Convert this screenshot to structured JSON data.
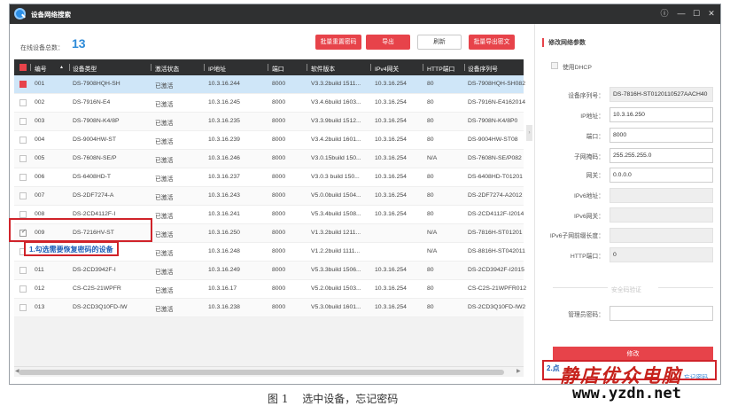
{
  "window": {
    "title": "设备网络搜索",
    "info_icon": "ⓘ",
    "min_icon": "—",
    "max_icon": "☐",
    "close_icon": "✕"
  },
  "toolbar": {
    "online_label": "在线设备总数：",
    "online_count": "13",
    "batch_reset_label": "批量重置密码",
    "export_label": "导出",
    "refresh_label": "刷新",
    "batch_export_label": "批量导出密文"
  },
  "table": {
    "columns": [
      "编号",
      "设备类型",
      "激活状态",
      "IP地址",
      "端口",
      "软件版本",
      "IPv4网关",
      "HTTP端口",
      "设备序列号"
    ],
    "rows": [
      {
        "id": "001",
        "type": "DS-7908HQH-SH",
        "status": "已激活",
        "ip": "10.3.16.244",
        "port": "8000",
        "version": "V3.3.2build 1511...",
        "gateway": "10.3.16.254",
        "http": "80",
        "serial": "DS-7908HQH-SH082"
      },
      {
        "id": "002",
        "type": "DS-7916N-E4",
        "status": "已激活",
        "ip": "10.3.16.245",
        "port": "8000",
        "version": "V3.4.6build 1603...",
        "gateway": "10.3.16.254",
        "http": "80",
        "serial": "DS-7916N-E4162014"
      },
      {
        "id": "003",
        "type": "DS-7908N-K4/8P",
        "status": "已激活",
        "ip": "10.3.16.235",
        "port": "8000",
        "version": "V3.3.9build 1512...",
        "gateway": "10.3.16.254",
        "http": "80",
        "serial": "DS-7908N-K4/8P0"
      },
      {
        "id": "004",
        "type": "DS-9004HW-ST",
        "status": "已激活",
        "ip": "10.3.16.239",
        "port": "8000",
        "version": "V3.4.2build 1601...",
        "gateway": "10.3.16.254",
        "http": "80",
        "serial": "DS-9004HW-ST08"
      },
      {
        "id": "005",
        "type": "DS-7608N-SE/P",
        "status": "已激活",
        "ip": "10.3.16.246",
        "port": "8000",
        "version": "V3.0.15build 150...",
        "gateway": "10.3.16.254",
        "http": "N/A",
        "serial": "DS-7608N-SE/P082"
      },
      {
        "id": "006",
        "type": "DS-6408HD-T",
        "status": "已激活",
        "ip": "10.3.16.237",
        "port": "8000",
        "version": "V3.0.3 build 150...",
        "gateway": "10.3.16.254",
        "http": "80",
        "serial": "DS-6408HD-T01201"
      },
      {
        "id": "007",
        "type": "DS-2DF7274-A",
        "status": "已激活",
        "ip": "10.3.16.243",
        "port": "8000",
        "version": "V5.0.0build 1504...",
        "gateway": "10.3.16.254",
        "http": "80",
        "serial": "DS-2DF7274-A2012"
      },
      {
        "id": "008",
        "type": "DS-2CD4112F-I",
        "status": "已激活",
        "ip": "10.3.16.241",
        "port": "8000",
        "version": "V5.3.4build 1508...",
        "gateway": "10.3.16.254",
        "http": "80",
        "serial": "DS-2CD4112F-I2014"
      },
      {
        "id": "009",
        "type": "DS-7216HV-ST",
        "status": "已激活",
        "ip": "10.3.16.250",
        "port": "8000",
        "version": "V1.3.2build 1211...",
        "gateway": "",
        "http": "N/A",
        "serial": "DS-7816H-ST01201"
      },
      {
        "id": "010",
        "type": "",
        "status": "已激活",
        "ip": "10.3.16.248",
        "port": "8000",
        "version": "V1.2.2build 1111...",
        "gateway": "",
        "http": "N/A",
        "serial": "DS-8816H-ST042011"
      },
      {
        "id": "011",
        "type": "DS-2CD3942F-I",
        "status": "已激活",
        "ip": "10.3.16.249",
        "port": "8000",
        "version": "V5.3.3build 1506...",
        "gateway": "10.3.16.254",
        "http": "80",
        "serial": "DS-2CD3942F-I2015"
      },
      {
        "id": "012",
        "type": "CS-C2S-21WPFR",
        "status": "已激活",
        "ip": "10.3.16.17",
        "port": "8000",
        "version": "V5.2.0build 1503...",
        "gateway": "10.3.16.254",
        "http": "80",
        "serial": "CS-C2S-21WPFR012"
      },
      {
        "id": "013",
        "type": "DS-2CD3Q10FD-IW",
        "status": "已激活",
        "ip": "10.3.16.238",
        "port": "8000",
        "version": "V5.3.0build 1601...",
        "gateway": "10.3.16.254",
        "http": "80",
        "serial": "DS-2CD3Q10FD-IW2"
      }
    ]
  },
  "panel": {
    "title": "修改网络参数",
    "dhcp_label": "使用DHCP",
    "serial_label": "设备序列号：",
    "serial_value": "DS-7816H-ST0120110527AACH40",
    "ip_label": "IP地址：",
    "ip_value": "10.3.16.250",
    "port_label": "端口：",
    "port_value": "8000",
    "mask_label": "子网掩码：",
    "mask_value": "255.255.255.0",
    "gateway_label": "网关：",
    "gateway_value": "0.0.0.0",
    "ipv6_addr_label": "IPv6地址：",
    "ipv6_gw_label": "IPv6网关：",
    "ipv6_prefix_label": "IPv6子网前缀长度：",
    "http_label": "HTTP端口：",
    "http_value": "0",
    "security_title": "安全码验证",
    "admin_pwd_label": "管理员密码：",
    "modify_label": "修改",
    "forgot_link": "忘记密码"
  },
  "annotations": {
    "step1": "1.勾选需要恢复密码的设备",
    "step2": "2.点"
  },
  "watermark": {
    "site_name": "静店优众电脑",
    "url": "www.yzdn.net"
  },
  "caption": "图 1　 选中设备，忘记密码",
  "colors": {
    "accent_red": "#e7434a",
    "titlebar_dark": "#2f3031",
    "selected_row": "#cfe6f8",
    "count_blue": "#2e8bd8"
  }
}
